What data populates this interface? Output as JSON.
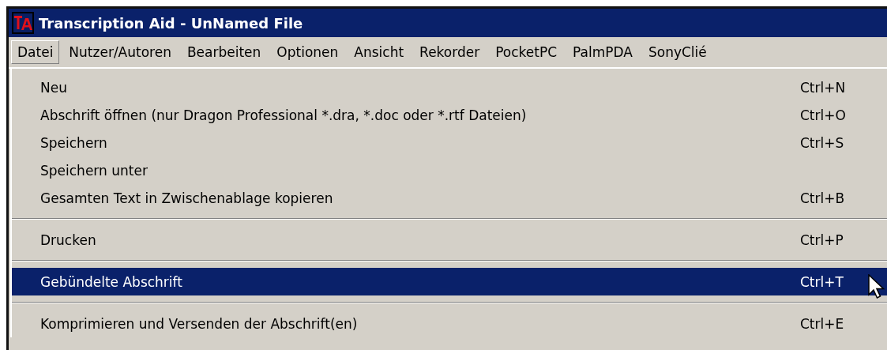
{
  "window": {
    "title": "Transcription Aid - UnNamed File"
  },
  "menu_bar": [
    {
      "label": "Datei",
      "selected": true
    },
    {
      "label": "Nutzer/Autoren",
      "selected": false
    },
    {
      "label": "Bearbeiten",
      "selected": false
    },
    {
      "label": "Optionen",
      "selected": false
    },
    {
      "label": "Ansicht",
      "selected": false
    },
    {
      "label": "Rekorder",
      "selected": false
    },
    {
      "label": "PocketPC",
      "selected": false
    },
    {
      "label": "PalmPDA",
      "selected": false
    },
    {
      "label": "SonyClié",
      "selected": false
    }
  ],
  "menu": [
    {
      "kind": "item",
      "label": "Neu",
      "shortcut": "Ctrl+N",
      "selected": false
    },
    {
      "kind": "item",
      "label": "Abschrift öffnen (nur Dragon Professional *.dra, *.doc oder *.rtf Dateien)",
      "shortcut": "Ctrl+O",
      "selected": false
    },
    {
      "kind": "item",
      "label": "Speichern",
      "shortcut": "Ctrl+S",
      "selected": false
    },
    {
      "kind": "item",
      "label": "Speichern unter",
      "selected": false
    },
    {
      "kind": "item",
      "label": "Gesamten Text in Zwischenablage kopieren",
      "shortcut": "Ctrl+B",
      "selected": false
    },
    {
      "kind": "separator"
    },
    {
      "kind": "item",
      "label": "Drucken",
      "shortcut": "Ctrl+P",
      "selected": false
    },
    {
      "kind": "separator"
    },
    {
      "kind": "item",
      "label": "Gebündelte Abschrift",
      "shortcut": "Ctrl+T",
      "selected": true
    },
    {
      "kind": "separator"
    },
    {
      "kind": "item",
      "label": "Komprimieren und Versenden der Abschrift(en)",
      "shortcut": "Ctrl+E",
      "selected": false
    }
  ]
}
